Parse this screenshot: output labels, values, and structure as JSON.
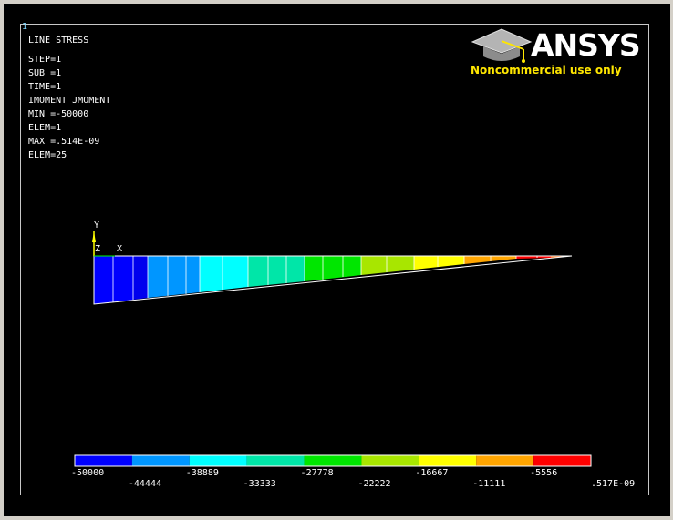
{
  "window": {
    "number": "1"
  },
  "legend": {
    "title": "LINE STRESS",
    "lines": [
      "STEP=1",
      "SUB =1",
      "TIME=1",
      "IMOMENT JMOMENT",
      "MIN =-50000",
      "ELEM=1",
      "MAX =.514E-09",
      "ELEM=25"
    ]
  },
  "logo": {
    "word": "ANSYS",
    "subtitle": "Noncommercial use only",
    "brand_color": "#ffe600",
    "icon": "mortarboard-icon"
  },
  "axes": {
    "y_label": "Y",
    "x_label": "X"
  },
  "colorbar": {
    "colors": [
      "#0000ff",
      "#0096ff",
      "#00ffff",
      "#00e6a8",
      "#00e600",
      "#a8e600",
      "#ffff00",
      "#ffa500",
      "#ff0000"
    ],
    "labels_top": [
      "-50000",
      "-38889",
      "-27778",
      "-16667",
      "-5556"
    ],
    "labels_bottom": [
      "-44444",
      "-33333",
      "-22222",
      "-11111",
      ".517E-09"
    ]
  }
}
